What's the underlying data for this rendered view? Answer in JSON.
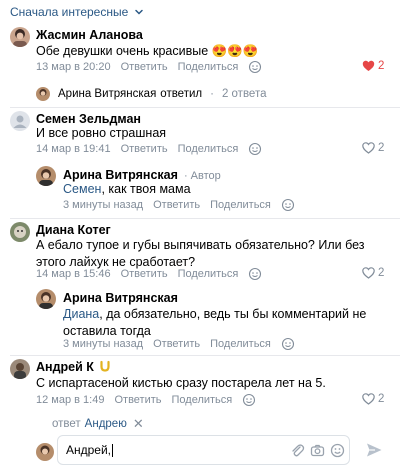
{
  "sort": {
    "label": "Сначала интересные"
  },
  "comments": [
    {
      "author": "Жасмин Аланова",
      "text": "Обе девушки очень красивые 😍😍😍",
      "time": "13 мар в 20:20",
      "reply": "Ответить",
      "share": "Поделиться",
      "likes": "2",
      "liked": true
    },
    {
      "author": "Семен Зельдман",
      "text": "И все ровно страшная",
      "time": "14 мар в 19:41",
      "reply": "Ответить",
      "share": "Поделиться",
      "likes": "2"
    },
    {
      "author": "Диана Котег",
      "text": "А ебало тупое и губы выпячивать обязательно? Или без этого лайхук не сработает?",
      "time": "14 мар в 15:46",
      "reply": "Ответить",
      "share": "Поделиться",
      "likes": "2"
    },
    {
      "author": "Андрей К",
      "text": "С испартасеной кистью сразу постарела лет на 5.",
      "time": "12 мар в 1:49",
      "reply": "Ответить",
      "share": "Поделиться",
      "likes": "2"
    }
  ],
  "replies_summary": {
    "author": "Арина Витрянская",
    "verb": "ответил",
    "count": "2 ответа"
  },
  "replies": [
    {
      "author": "Арина Витрянская",
      "badge": "· Автор",
      "mention": "Семен",
      "text": ", как твоя мама",
      "time": "3 минуты назад",
      "reply": "Ответить",
      "share": "Поделиться"
    },
    {
      "author": "Арина Витрянская",
      "mention": "Диана",
      "text": ", да обязательно, ведь ты бы комментарий не оставила тогда",
      "time": "3 минуты назад",
      "reply": "Ответить",
      "share": "Поделиться"
    }
  ],
  "composer": {
    "reply_prefix": "ответ",
    "reply_to": "Андрею",
    "value": "Андрей,"
  },
  "colors": {
    "link": "#2a5885",
    "muted": "#818c99",
    "like_active": "#e64646"
  }
}
